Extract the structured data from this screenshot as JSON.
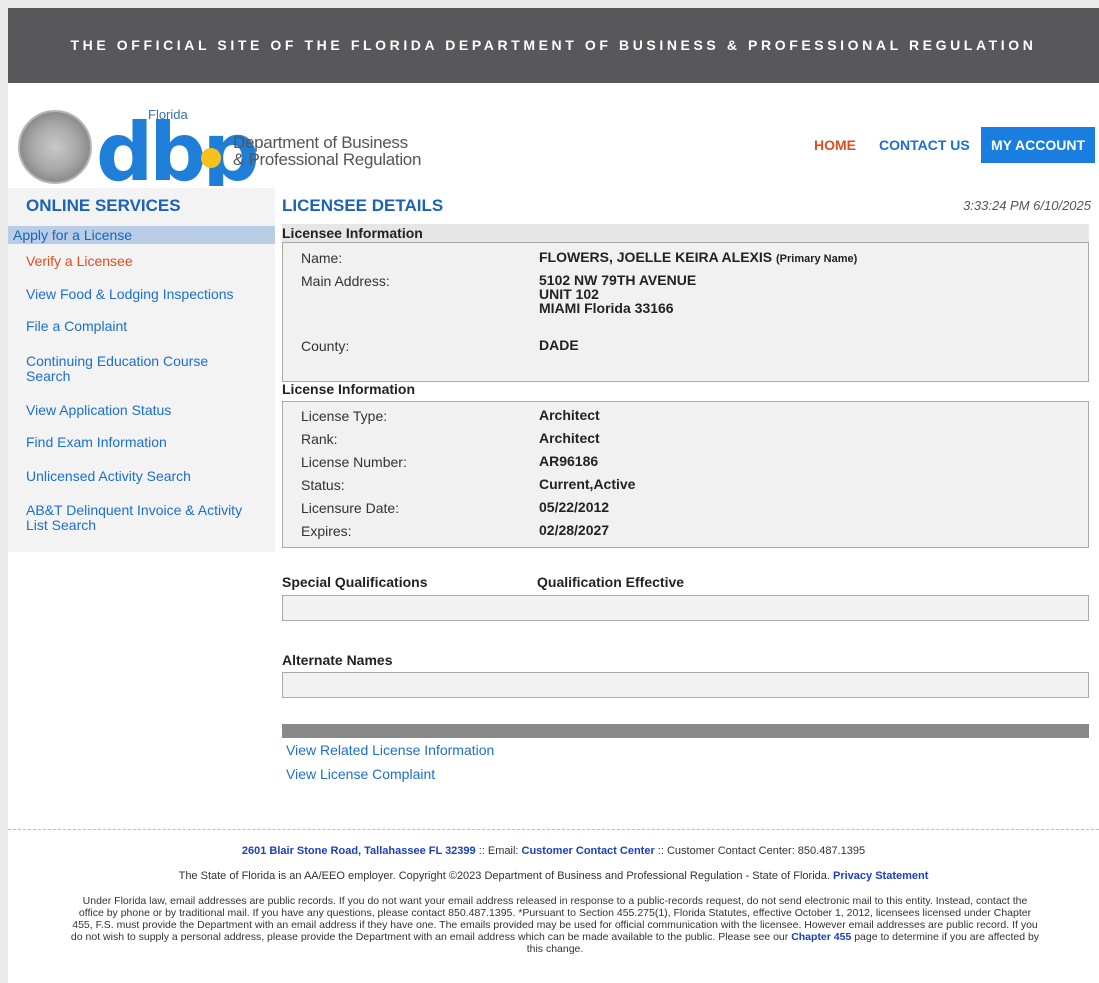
{
  "banner": {
    "text": "THE OFFICIAL SITE OF THE FLORIDA DEPARTMENT OF BUSINESS & PROFESSIONAL REGULATION"
  },
  "logo": {
    "florida": "Florida",
    "wordmark": "dbpr",
    "dept_line1": "Department of Business",
    "dept_line2": "& Professional Regulation"
  },
  "topnav": {
    "home": "HOME",
    "contact": "CONTACT US",
    "account": "MY ACCOUNT"
  },
  "sidebar": {
    "title": "ONLINE SERVICES",
    "apply": "Apply for a License",
    "items": [
      "Verify a Licensee",
      "View Food & Lodging Inspections",
      "File a Complaint",
      "Continuing Education Course Search",
      "View Application Status",
      "Find Exam Information",
      "Unlicensed Activity Search",
      "AB&T Delinquent Invoice & Activity List Search"
    ]
  },
  "main": {
    "title": "LICENSEE DETAILS",
    "timestamp": "3:33:24 PM 6/10/2025",
    "licensee_header": "Licensee Information",
    "licensee": {
      "name_label": "Name:",
      "name_value": "FLOWERS, JOELLE KEIRA ALEXIS",
      "name_note": "(Primary Name)",
      "address_label": "Main Address:",
      "address_line1": "5102 NW 79TH AVENUE",
      "address_line2": "UNIT 102",
      "address_line3": "MIAMI  Florida  33166",
      "county_label": "County:",
      "county_value": "DADE"
    },
    "license_header": "License Information",
    "license": {
      "type_label": "License Type:",
      "type_value": "Architect",
      "rank_label": "Rank:",
      "rank_value": "Architect",
      "number_label": "License Number:",
      "number_value": "AR96186",
      "status_label": "Status:",
      "status_value": "Current,Active",
      "date_label": "Licensure Date:",
      "date_value": "05/22/2012",
      "expires_label": "Expires:",
      "expires_value": "02/28/2027"
    },
    "special_header": "Special Qualifications",
    "qual_effective_header": "Qualification Effective",
    "alternate_header": "Alternate Names",
    "related_link": "View Related License Information",
    "complaint_link": "View License Complaint"
  },
  "footer": {
    "address": "2601 Blair Stone Road, Tallahassee FL 32399",
    "sep1": " :: Email: ",
    "email_link": "Customer Contact Center",
    "sep2": " :: Customer Contact Center: 850.487.1395",
    "eeo_text": "The State of Florida is an AA/EEO employer. Copyright ©2023 Department of Business and Professional Regulation - State of Florida. ",
    "privacy_link": "Privacy Statement",
    "legal_text": "Under Florida law, email addresses are public records. If you do not want your email address released in response to a public-records request, do not send electronic mail to this entity. Instead, contact the office by phone or by traditional mail. If you have any questions, please contact 850.487.1395. *Pursuant to Section 455.275(1), Florida Statutes, effective October 1, 2012, licensees licensed under Chapter 455, F.S. must provide the Department with an email address if they have one. The emails provided may be used for official communication with the licensee. However email addresses are public record. If you do not wish to supply a personal address, please provide the Department with an email address which can be made available to the public. Please see our ",
    "chapter_link": "Chapter 455",
    "legal_tail": " page to determine if you are affected by this change."
  },
  "colors": {
    "banner_bg": "#58585a",
    "brand_blue": "#1a63b5",
    "link_blue": "#1a6fd0",
    "active_orange": "#e04e1b",
    "account_bg": "#1a7ee0"
  }
}
